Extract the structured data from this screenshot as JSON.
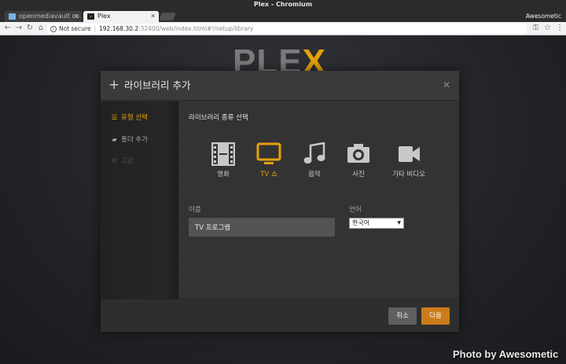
{
  "window": {
    "title": "Plex - Chromium",
    "profile": "Awesometic"
  },
  "tabs": [
    {
      "label": "openmediavault co",
      "active": false
    },
    {
      "label": "Plex",
      "active": true
    }
  ],
  "address": {
    "security": "Not secure",
    "host": "192.168.30.2",
    "path": ":32400/web/index.html#!/setup/library"
  },
  "icons": {
    "back": "arrow-left",
    "forward": "arrow-right",
    "reload": "reload",
    "home": "home",
    "key": "key",
    "star": "star",
    "menu": "vertical-dots",
    "movie": "film-strip",
    "tv": "television",
    "music": "music-note",
    "photo": "camera",
    "other": "video-camera"
  },
  "logo": {
    "text": "PLE",
    "accent": "X"
  },
  "modal": {
    "title": "라이브러리 추가",
    "sidebar": [
      {
        "label": "유형 선택",
        "state": "active"
      },
      {
        "label": "폴더 추가",
        "state": "normal"
      },
      {
        "label": "고급",
        "state": "disabled"
      }
    ],
    "section_title": "라이브러리 종류 선택",
    "types": [
      {
        "label": "영화"
      },
      {
        "label": "TV 쇼",
        "selected": true
      },
      {
        "label": "음악"
      },
      {
        "label": "사진"
      },
      {
        "label": "기타 비디오"
      }
    ],
    "name": {
      "label": "이름",
      "value": "TV 프로그램"
    },
    "language": {
      "label": "언어",
      "value": "한국어"
    },
    "buttons": {
      "cancel": "취소",
      "next": "다음"
    }
  },
  "colors": {
    "accent": "#e5a00d",
    "next_button": "#cc7b19",
    "background": "#222327"
  },
  "watermark": "Photo by Awesometic"
}
